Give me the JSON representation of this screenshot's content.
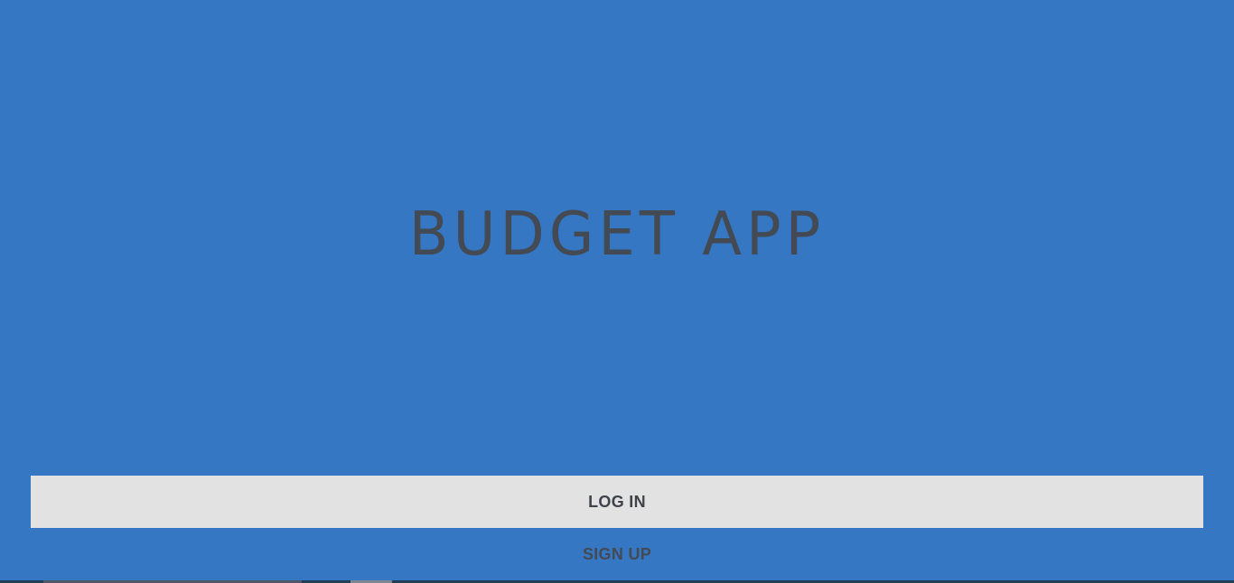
{
  "app": {
    "title": "BUDGET APP"
  },
  "actions": {
    "login_label": "LOG IN",
    "signup_label": "SIGN UP"
  },
  "colors": {
    "background": "#3677c3",
    "button_bg": "#e2e2e2",
    "text": "#434a54"
  }
}
